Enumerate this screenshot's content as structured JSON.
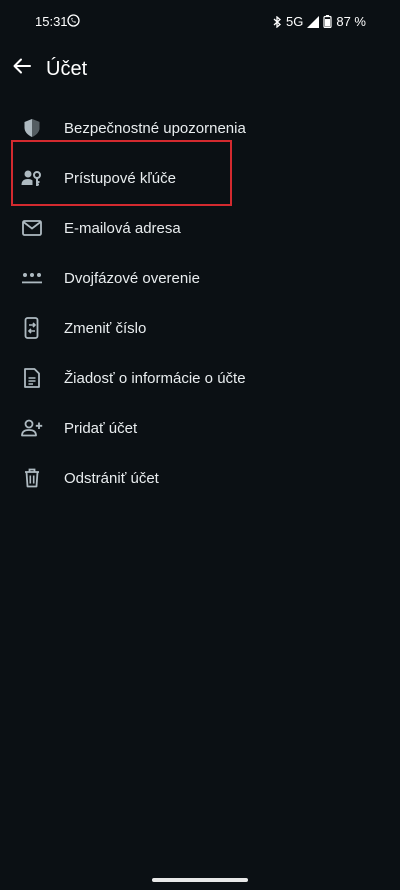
{
  "status_bar": {
    "time": "15:31",
    "network": "5G",
    "battery": "87 %"
  },
  "app_bar": {
    "title": "Účet",
    "back_icon": "arrow-back-icon"
  },
  "menu": {
    "items": [
      {
        "label": "Bezpečnostné upozornenia",
        "icon": "shield-icon"
      },
      {
        "label": "Prístupové kľúče",
        "icon": "passkey-icon"
      },
      {
        "label": "E-mailová adresa",
        "icon": "mail-icon"
      },
      {
        "label": "Dvojfázové overenie",
        "icon": "dots-icon",
        "highlighted": true
      },
      {
        "label": "Zmeniť číslo",
        "icon": "phone-change-icon"
      },
      {
        "label": "Žiadosť o informácie o účte",
        "icon": "document-icon"
      },
      {
        "label": "Pridať účet",
        "icon": "add-person-icon"
      },
      {
        "label": "Odstrániť účet",
        "icon": "trash-icon"
      }
    ]
  },
  "colors": {
    "background": "#0b1014",
    "text": "#e9edef",
    "icon": "#aebac1",
    "highlight_border": "#d32a2f"
  }
}
